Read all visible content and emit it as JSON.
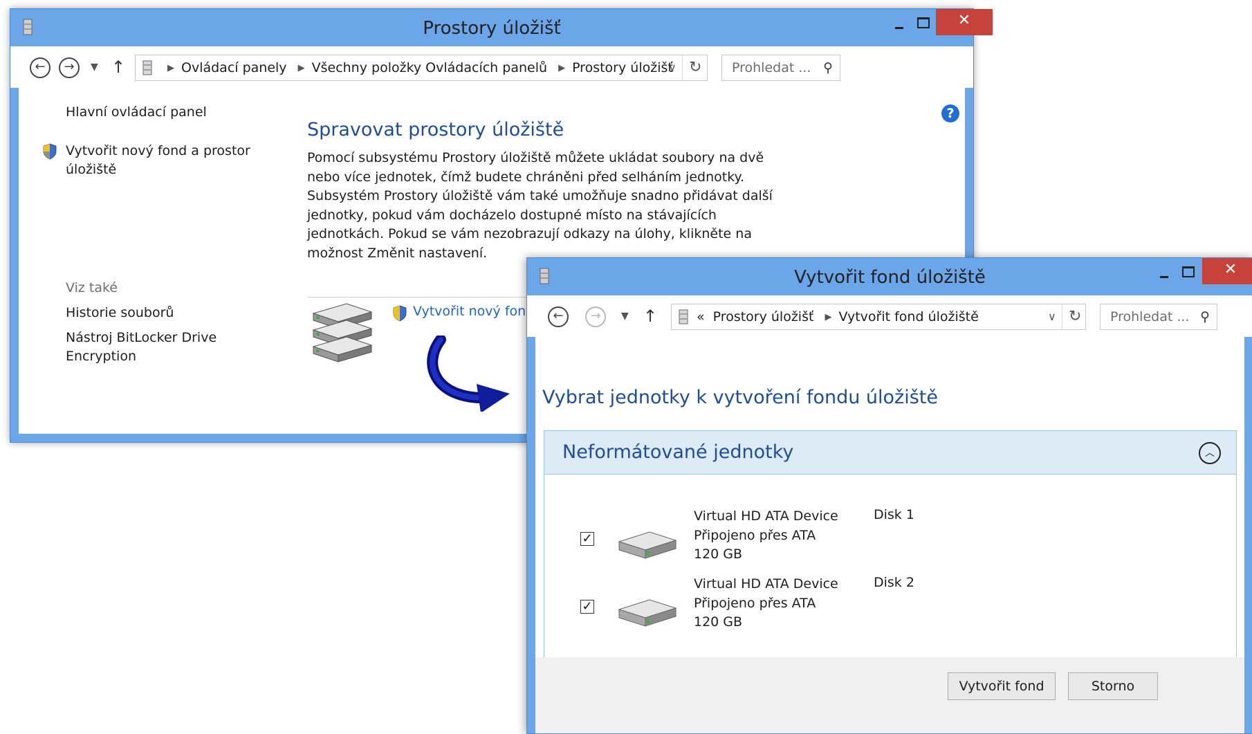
{
  "window1": {
    "title": "Prostory úložišť",
    "breadcrumb": [
      "Ovládací panely",
      "Všechny položky Ovládacích panelů",
      "Prostory úložišť"
    ],
    "search_placeholder": "Prohledat ...",
    "sidebar": {
      "main_link": "Hlavní ovládací panel",
      "create_link_line1": "Vytvořit nový fond a prostor",
      "create_link_line2": "úložiště",
      "see_also": "Viz také",
      "related": [
        "Historie souborů",
        "Nástroj BitLocker Drive",
        "Encryption"
      ]
    },
    "heading": "Spravovat prostory úložiště",
    "description": "Pomocí subsystému Prostory úložiště můžete ukládat soubory na dvě nebo více jednotek, čímž budete chráněni před selháním jednotky. Subsystém Prostory úložiště vám také umožňuje snadno přidávat další jednotky, pokud vám docházelo dostupné místo na stávajících jednotkách. Pokud se vám nezobrazují odkazy na úlohy, klikněte na možnost Změnit nastavení.",
    "task_link": "Vytvořit nový fond"
  },
  "window2": {
    "title": "Vytvořit fond úložiště",
    "breadcrumb_prefix": "«",
    "breadcrumb": [
      "Prostory úložišť",
      "Vytvořit fond úložiště"
    ],
    "search_placeholder": "Prohledat ...",
    "heading": "Vybrat jednotky k vytvoření fondu úložiště",
    "group_title": "Neformátované jednotky",
    "drives": [
      {
        "name": "Virtual HD ATA Device",
        "connection": "Připojeno přes ATA",
        "size": "120 GB",
        "disk": "Disk 1",
        "checked": true
      },
      {
        "name": "Virtual HD ATA Device",
        "connection": "Připojeno přes ATA",
        "size": "120 GB",
        "disk": "Disk 2",
        "checked": true
      }
    ],
    "buttons": {
      "create": "Vytvořit fond",
      "cancel": "Storno"
    }
  },
  "icons": {
    "back": "back-arrow-icon",
    "forward": "forward-arrow-icon",
    "up": "up-arrow-icon",
    "refresh": "refresh-icon",
    "search": "search-icon",
    "help": "help-icon",
    "shield": "uac-shield-icon",
    "storage": "storage-spaces-icon",
    "hdd": "hard-drive-icon"
  },
  "colors": {
    "titlebar": "#6ba6e8",
    "close": "#c7423a",
    "heading": "#1e4e9a",
    "link": "#1e66c9",
    "group_header": "#dcebf6"
  }
}
